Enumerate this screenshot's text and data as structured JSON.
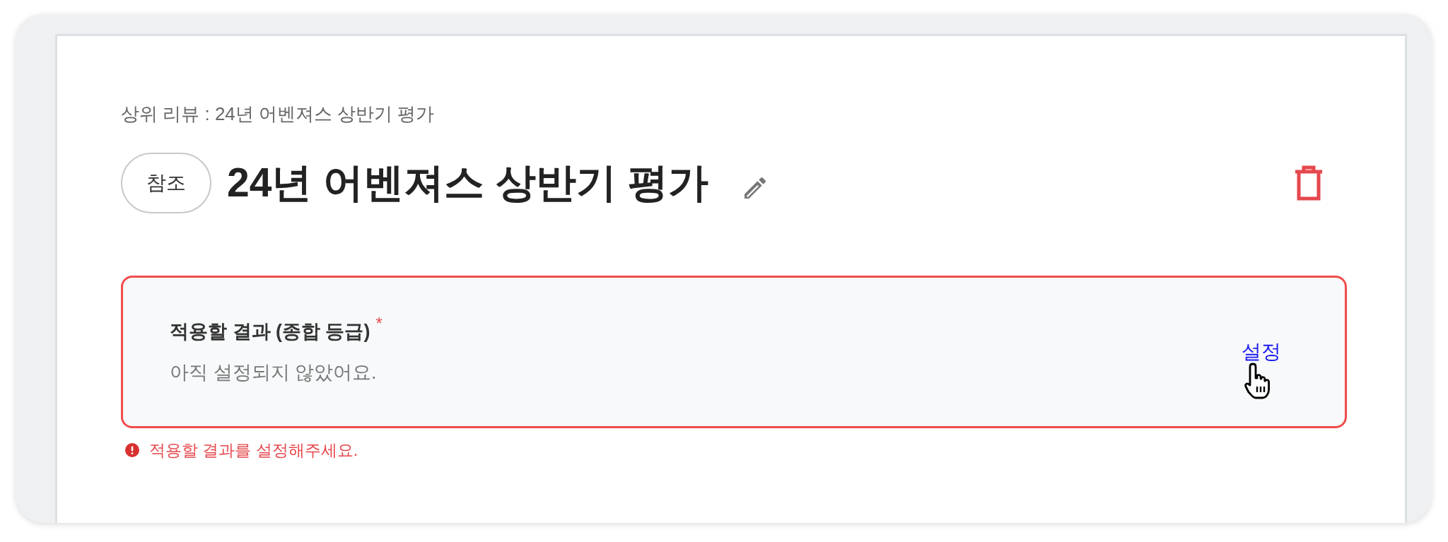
{
  "breadcrumb": "상위 리뷰 : 24년 어벤져스 상반기 평가",
  "header": {
    "badge": "참조",
    "title": "24년 어벤져스 상반기 평가"
  },
  "field": {
    "label": "적용할 결과 (종합 등급)",
    "required": true,
    "required_mark": "*",
    "value": "아직 설정되지 않았어요.",
    "action": "설정",
    "error": true,
    "error_message": "적용할 결과를 설정해주세요."
  }
}
